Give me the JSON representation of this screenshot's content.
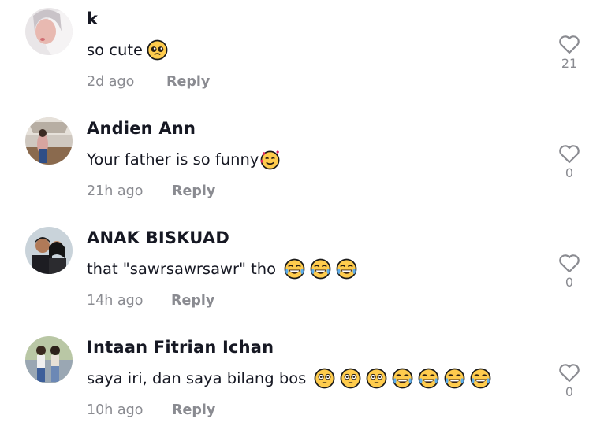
{
  "comments": [
    {
      "username": "k",
      "text": "so cute",
      "emojis": [
        "pleading-face-emoji"
      ],
      "time": "2d ago",
      "reply_label": "Reply",
      "likes": "21"
    },
    {
      "username": "Andien Ann",
      "text": "Your father is so funny",
      "emojis": [
        "smiling-face-with-hearts-emoji"
      ],
      "time": "21h ago",
      "reply_label": "Reply",
      "likes": "0"
    },
    {
      "username": "ANAK BISKUAD",
      "text": "that \"sawrsawrsawr\" tho",
      "emojis": [
        "tears-of-joy-emoji",
        "tears-of-joy-emoji",
        "tears-of-joy-emoji"
      ],
      "time": "14h ago",
      "reply_label": "Reply",
      "likes": "0"
    },
    {
      "username": "Intaan Fitrian Ichan",
      "text": "saya iri, dan saya bilang bos",
      "emojis": [
        "flushed-face-emoji",
        "flushed-face-emoji",
        "flushed-face-emoji",
        "tears-of-joy-emoji",
        "tears-of-joy-emoji",
        "tears-of-joy-emoji",
        "tears-of-joy-emoji"
      ],
      "time": "10h ago",
      "reply_label": "Reply",
      "likes": "0"
    }
  ],
  "colors": {
    "text": "#161823",
    "muted": "#8a8b91",
    "emoji_yellow": "#ffcc4d"
  }
}
